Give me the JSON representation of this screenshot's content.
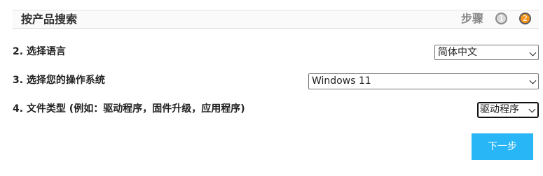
{
  "header": {
    "title": "按产品搜索",
    "steps_label": "步骤",
    "steps": [
      "1",
      "2"
    ]
  },
  "rows": [
    {
      "label": "2. 选择语言",
      "selected": "简体中文"
    },
    {
      "label": "3. 选择您的操作系统",
      "selected": "Windows 11"
    },
    {
      "label": "4. 文件类型 (例如：驱动程序，固件升级，应用程序)",
      "selected": "驱动程序"
    }
  ],
  "next_button": "下一步",
  "colors": {
    "accent": "#29b6f6",
    "active_step": "#f7941d",
    "inactive_step": "#d9d9d9"
  }
}
